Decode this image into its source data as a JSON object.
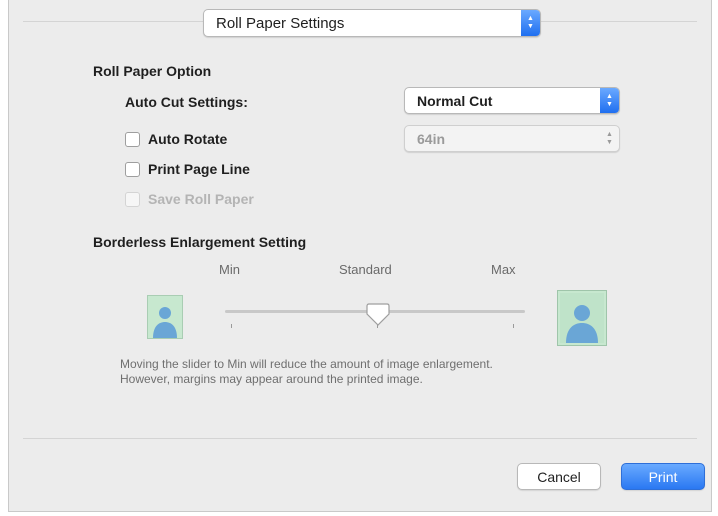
{
  "header": {
    "menu_label": "Roll Paper Settings"
  },
  "roll_paper_option": {
    "title": "Roll Paper Option",
    "auto_cut_label": "Auto Cut Settings:",
    "auto_cut_value": "Normal Cut",
    "auto_rotate_label": "Auto Rotate",
    "length_value": "64in",
    "print_page_line_label": "Print Page Line",
    "save_roll_paper_label": "Save Roll Paper"
  },
  "borderless": {
    "title": "Borderless Enlargement Setting",
    "min_label": "Min",
    "standard_label": "Standard",
    "max_label": "Max",
    "description_line1": "Moving the slider to Min will reduce the amount of image enlargement.",
    "description_line2": "However, margins may appear around the printed image."
  },
  "footer": {
    "cancel_label": "Cancel",
    "print_label": "Print"
  },
  "colors": {
    "accent": "#2a78f2",
    "preview_fill": "#bfe3c9",
    "preview_figure": "#6aa6d6"
  },
  "icons": {
    "popup_arrows": "chevron-up-down-icon",
    "small_preview": "person-small-icon",
    "large_preview": "person-large-icon",
    "slider_thumb": "slider-thumb-icon"
  }
}
